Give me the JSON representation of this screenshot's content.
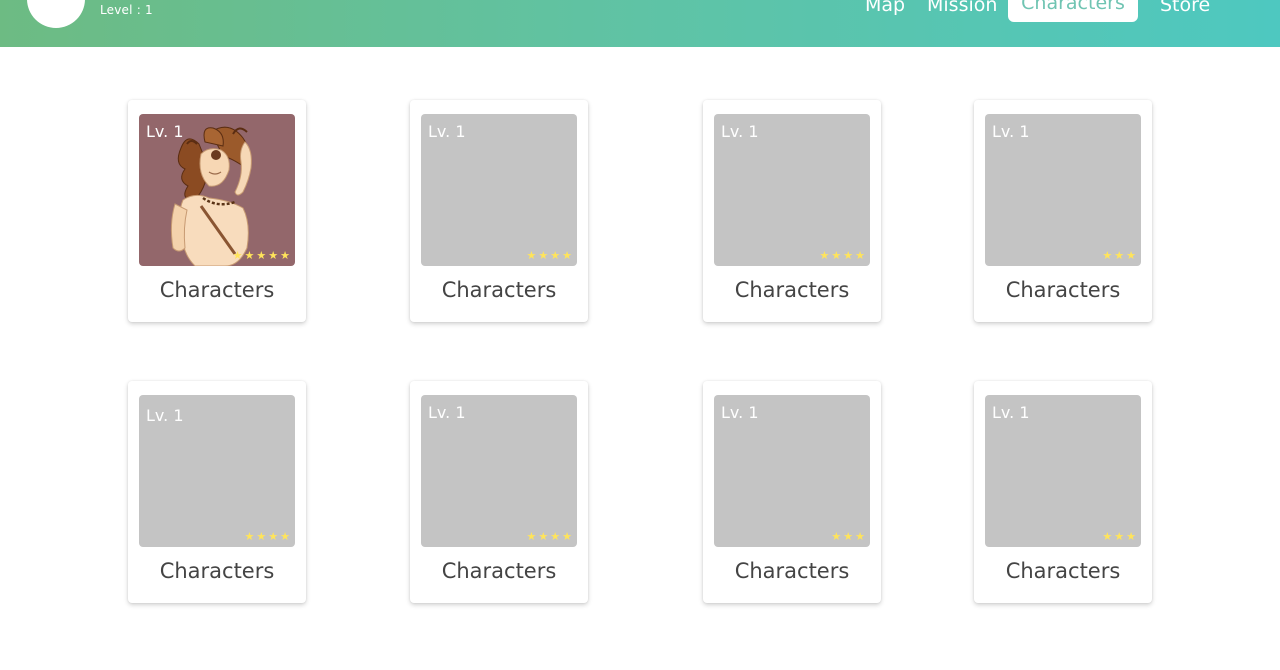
{
  "header": {
    "level_text": "Level : 1",
    "nav": [
      {
        "label": "Map"
      },
      {
        "label": "Mission"
      },
      {
        "label": "Characters"
      },
      {
        "label": "Store"
      }
    ],
    "active_tab": "Characters"
  },
  "cards": [
    {
      "level": "Lv. 1",
      "name": "Characters",
      "stars": 5,
      "image": "character-portrait"
    },
    {
      "level": "Lv. 1",
      "name": "Characters",
      "stars": 4,
      "image": "placeholder"
    },
    {
      "level": "Lv. 1",
      "name": "Characters",
      "stars": 4,
      "image": "placeholder"
    },
    {
      "level": "Lv. 1",
      "name": "Characters",
      "stars": 3,
      "image": "placeholder"
    },
    {
      "level": "Lv. 1",
      "name": "Characters",
      "stars": 4,
      "image": "placeholder"
    },
    {
      "level": "Lv. 1",
      "name": "Characters",
      "stars": 4,
      "image": "placeholder"
    },
    {
      "level": "Lv. 1",
      "name": "Characters",
      "stars": 3,
      "image": "placeholder"
    },
    {
      "level": "Lv. 1",
      "name": "Characters",
      "stars": 3,
      "image": "placeholder"
    }
  ],
  "colors": {
    "header_gradient_start": "#6dbb83",
    "header_gradient_end": "#4ec8c0",
    "placeholder": "#c4c4c4",
    "portrait_bg": "#93676b",
    "star": "#ffe45a"
  }
}
